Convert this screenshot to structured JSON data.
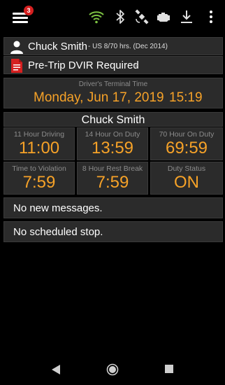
{
  "header": {
    "notification_count": "3",
    "icons": [
      "menu-icon",
      "wifi-icon",
      "bluetooth-icon",
      "satellite-icon",
      "engine-icon",
      "download-icon",
      "more-vert-icon"
    ],
    "wifi_color": "#7cc242"
  },
  "driver": {
    "name": "Chuck Smith",
    "ruleset": "- US 8/70 hrs. (Dec 2014)"
  },
  "dvir": {
    "label": "Pre-Trip DVIR Required",
    "chevron": "›"
  },
  "terminal_time": {
    "label": "Driver's Terminal Time",
    "date": "Monday, Jun 17, 2019",
    "time": "15:19"
  },
  "hos": {
    "driver_name": "Chuck Smith",
    "cells": [
      {
        "label": "11 Hour Driving",
        "value": "11:00"
      },
      {
        "label": "14 Hour On Duty",
        "value": "13:59"
      },
      {
        "label": "70 Hour On Duty",
        "value": "69:59"
      },
      {
        "label": "Time to Violation",
        "value": "7:59"
      },
      {
        "label": "8 Hour Rest Break",
        "value": "7:59"
      },
      {
        "label": "Duty Status",
        "value": "ON"
      }
    ]
  },
  "messages": {
    "text": "No new messages."
  },
  "stops": {
    "text": "No scheduled stop."
  },
  "colors": {
    "accent": "#f6a228",
    "panel": "#2b2b2b",
    "badge": "#d62020"
  }
}
